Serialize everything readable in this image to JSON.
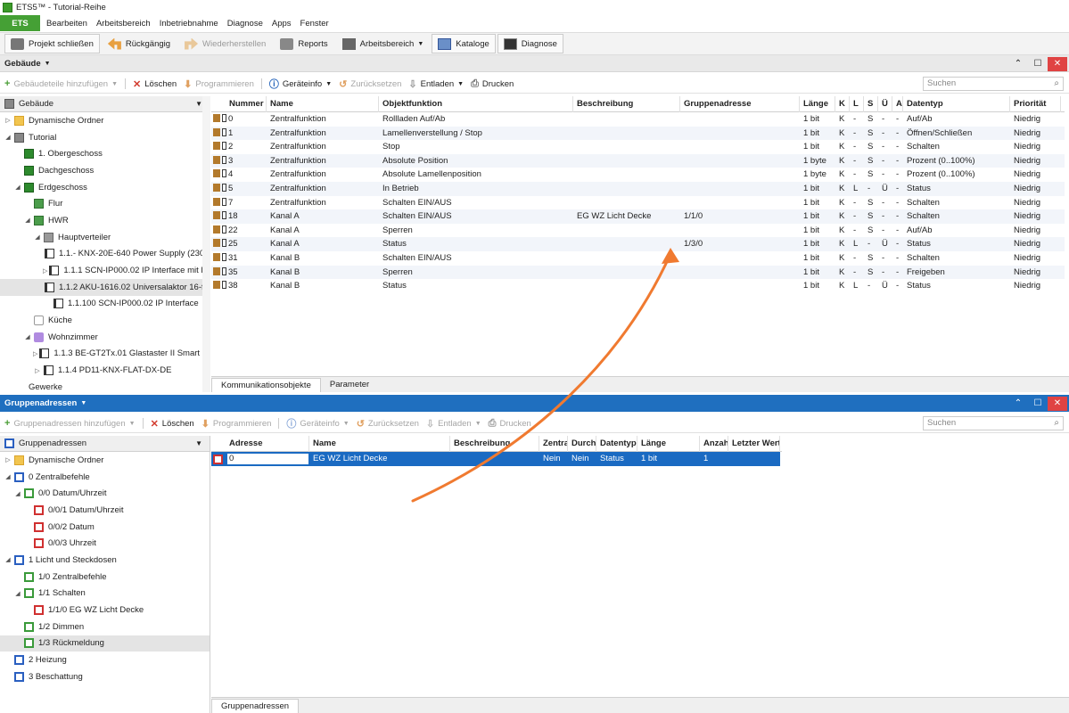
{
  "window": {
    "title": "ETS5™ - Tutorial-Reihe"
  },
  "menubar": {
    "ets": "ETS",
    "items": [
      "Bearbeiten",
      "Arbeitsbereich",
      "Inbetriebnahme",
      "Diagnose",
      "Apps",
      "Fenster"
    ]
  },
  "toolbar": {
    "close_project": "Projekt schließen",
    "undo": "Rückgängig",
    "redo": "Wiederherstellen",
    "reports": "Reports",
    "workspace": "Arbeitsbereich",
    "catalogs": "Kataloge",
    "diagnostics": "Diagnose"
  },
  "building_panel": {
    "title": "Gebäude",
    "toolbar": {
      "add": "Gebäudeteile hinzufügen",
      "delete": "Löschen",
      "program": "Programmieren",
      "device_info": "Geräteinfo",
      "reset": "Zurücksetzen",
      "unload": "Entladen",
      "print": "Drucken",
      "search_placeholder": "Suchen"
    },
    "tree_header": "Gebäude",
    "tree": [
      {
        "label": "Dynamische Ordner",
        "icon": "folder-icon",
        "level": 0,
        "arrow": "▷"
      },
      {
        "label": "Tutorial",
        "icon": "building-icon",
        "level": 0,
        "arrow": "◢"
      },
      {
        "label": "1. Obergeschoss",
        "icon": "floor-icon",
        "level": 1,
        "arrow": ""
      },
      {
        "label": "Dachgeschoss",
        "icon": "floor-icon",
        "level": 1,
        "arrow": ""
      },
      {
        "label": "Erdgeschoss",
        "icon": "floor-icon",
        "level": 1,
        "arrow": "◢"
      },
      {
        "label": "Flur",
        "icon": "room-icon",
        "level": 2,
        "arrow": ""
      },
      {
        "label": "HWR",
        "icon": "room-icon",
        "level": 2,
        "arrow": "◢"
      },
      {
        "label": "Hauptverteiler",
        "icon": "cabinet-icon",
        "level": 3,
        "arrow": "◢"
      },
      {
        "label": "1.1.- KNX-20E-640 Power Supply (230...",
        "icon": "device-icon",
        "level": 4,
        "arrow": ""
      },
      {
        "label": "1.1.1 SCN-IP000.02 IP Interface mit E...",
        "icon": "device-icon",
        "level": 4,
        "arrow": "▷"
      },
      {
        "label": "1.1.2 AKU-1616.02 Universalaktor 16-f...",
        "icon": "device-icon",
        "level": 4,
        "arrow": "",
        "selected": true
      },
      {
        "label": "1.1.100 SCN-IP000.02 IP Interface",
        "icon": "device-icon",
        "level": 4,
        "arrow": ""
      },
      {
        "label": "Küche",
        "icon": "kitchen-icon",
        "level": 2,
        "arrow": ""
      },
      {
        "label": "Wohnzimmer",
        "icon": "living-room-icon",
        "level": 2,
        "arrow": "◢"
      },
      {
        "label": "1.1.3 BE-GT2Tx.01 Glastaster II Smart mi...",
        "icon": "device-icon",
        "level": 3,
        "arrow": "▷"
      },
      {
        "label": "1.1.4 PD11-KNX-FLAT-DX-DE",
        "icon": "device-icon",
        "level": 3,
        "arrow": "▷"
      },
      {
        "label": "Gewerke",
        "icon": "trades-icon",
        "level": 0,
        "arrow": ""
      }
    ],
    "columns": [
      "Nummer",
      "Name",
      "Objektfunktion",
      "Beschreibung",
      "Gruppenadresse",
      "Länge",
      "K",
      "L",
      "S",
      "Ü",
      "A",
      "Datentyp",
      "Priorität"
    ],
    "rows": [
      [
        "0",
        "Zentralfunktion",
        "Rollladen Auf/Ab",
        "",
        "",
        "1 bit",
        "K",
        "-",
        "S",
        "-",
        "-",
        "Auf/Ab",
        "Niedrig"
      ],
      [
        "1",
        "Zentralfunktion",
        "Lamellenverstellung / Stop",
        "",
        "",
        "1 bit",
        "K",
        "-",
        "S",
        "-",
        "-",
        "Öffnen/Schließen",
        "Niedrig"
      ],
      [
        "2",
        "Zentralfunktion",
        "Stop",
        "",
        "",
        "1 bit",
        "K",
        "-",
        "S",
        "-",
        "-",
        "Schalten",
        "Niedrig"
      ],
      [
        "3",
        "Zentralfunktion",
        "Absolute Position",
        "",
        "",
        "1 byte",
        "K",
        "-",
        "S",
        "-",
        "-",
        "Prozent (0..100%)",
        "Niedrig"
      ],
      [
        "4",
        "Zentralfunktion",
        "Absolute Lamellenposition",
        "",
        "",
        "1 byte",
        "K",
        "-",
        "S",
        "-",
        "-",
        "Prozent (0..100%)",
        "Niedrig"
      ],
      [
        "5",
        "Zentralfunktion",
        "In Betrieb",
        "",
        "",
        "1 bit",
        "K",
        "L",
        "-",
        "Ü",
        "-",
        "Status",
        "Niedrig"
      ],
      [
        "7",
        "Zentralfunktion",
        "Schalten EIN/AUS",
        "",
        "",
        "1 bit",
        "K",
        "-",
        "S",
        "-",
        "-",
        "Schalten",
        "Niedrig"
      ],
      [
        "18",
        "Kanal A",
        "Schalten EIN/AUS",
        "EG WZ Licht Decke",
        "1/1/0",
        "1 bit",
        "K",
        "-",
        "S",
        "-",
        "-",
        "Schalten",
        "Niedrig"
      ],
      [
        "22",
        "Kanal A",
        "Sperren",
        "",
        "",
        "1 bit",
        "K",
        "-",
        "S",
        "-",
        "-",
        "Auf/Ab",
        "Niedrig"
      ],
      [
        "25",
        "Kanal A",
        "Status",
        "",
        "1/3/0",
        "1 bit",
        "K",
        "L",
        "-",
        "Ü",
        "-",
        "Status",
        "Niedrig"
      ],
      [
        "31",
        "Kanal B",
        "Schalten EIN/AUS",
        "",
        "",
        "1 bit",
        "K",
        "-",
        "S",
        "-",
        "-",
        "Schalten",
        "Niedrig"
      ],
      [
        "35",
        "Kanal B",
        "Sperren",
        "",
        "",
        "1 bit",
        "K",
        "-",
        "S",
        "-",
        "-",
        "Freigeben",
        "Niedrig"
      ],
      [
        "38",
        "Kanal B",
        "Status",
        "",
        "",
        "1 bit",
        "K",
        "L",
        "-",
        "Ü",
        "-",
        "Status",
        "Niedrig"
      ]
    ],
    "tabs": [
      "Kommunikationsobjekte",
      "Parameter"
    ]
  },
  "ga_panel": {
    "title": "Gruppenadressen",
    "toolbar": {
      "add": "Gruppenadressen hinzufügen",
      "delete": "Löschen",
      "program": "Programmieren",
      "device_info": "Geräteinfo",
      "reset": "Zurücksetzen",
      "unload": "Entladen",
      "print": "Drucken",
      "search_placeholder": "Suchen"
    },
    "tree_header": "Gruppenadressen",
    "tree": [
      {
        "label": "Dynamische Ordner",
        "icon": "folder-icon",
        "level": 0,
        "arrow": "▷"
      },
      {
        "label": "0 Zentralbefehle",
        "icon": "main-group-icon",
        "level": 0,
        "arrow": "◢"
      },
      {
        "label": "0/0 Datum/Uhrzeit",
        "icon": "middle-group-icon",
        "level": 1,
        "arrow": "◢"
      },
      {
        "label": "0/0/1 Datum/Uhrzeit",
        "icon": "group-address-icon",
        "level": 2,
        "arrow": ""
      },
      {
        "label": "0/0/2 Datum",
        "icon": "group-address-icon",
        "level": 2,
        "arrow": ""
      },
      {
        "label": "0/0/3 Uhrzeit",
        "icon": "group-address-icon",
        "level": 2,
        "arrow": ""
      },
      {
        "label": "1 Licht und Steckdosen",
        "icon": "main-group-icon",
        "level": 0,
        "arrow": "◢"
      },
      {
        "label": "1/0 Zentralbefehle",
        "icon": "middle-group-icon",
        "level": 1,
        "arrow": ""
      },
      {
        "label": "1/1 Schalten",
        "icon": "middle-group-icon",
        "level": 1,
        "arrow": "◢"
      },
      {
        "label": "1/1/0 EG WZ Licht Decke",
        "icon": "group-address-icon",
        "level": 2,
        "arrow": ""
      },
      {
        "label": "1/2 Dimmen",
        "icon": "middle-group-icon",
        "level": 1,
        "arrow": ""
      },
      {
        "label": "1/3 Rückmeldung",
        "icon": "middle-group-icon",
        "level": 1,
        "arrow": "",
        "selected": true
      },
      {
        "label": "2 Heizung",
        "icon": "main-group-icon",
        "level": 0,
        "arrow": ""
      },
      {
        "label": "3 Beschattung",
        "icon": "main-group-icon",
        "level": 0,
        "arrow": ""
      }
    ],
    "columns": [
      "Adresse",
      "Name",
      "Beschreibung",
      "Zentra",
      "Durch",
      "Datentyp",
      "Länge",
      "Anzah",
      "Letzter Wert"
    ],
    "rows": [
      [
        "0",
        "EG WZ Licht Decke",
        "",
        "Nein",
        "Nein",
        "Status",
        "1 bit",
        "1",
        ""
      ]
    ],
    "tabs": [
      "Gruppenadressen"
    ]
  },
  "colors": {
    "accent_blue": "#1f6fbf",
    "ets_green": "#45a035",
    "arrow_orange": "#f07a30"
  }
}
